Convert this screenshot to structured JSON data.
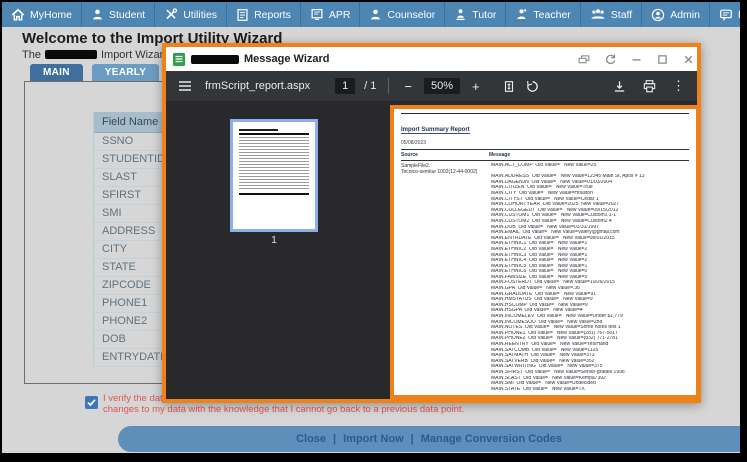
{
  "nav": {
    "items": [
      {
        "label": "MyHome",
        "icon": "home-icon"
      },
      {
        "label": "Student",
        "icon": "student-icon"
      },
      {
        "label": "Utilities",
        "icon": "utilities-icon"
      },
      {
        "label": "Reports",
        "icon": "reports-icon"
      },
      {
        "label": "APR",
        "icon": "apr-icon"
      },
      {
        "label": "Counselor",
        "icon": "counselor-icon"
      },
      {
        "label": "Tutor",
        "icon": "tutor-icon"
      },
      {
        "label": "Teacher",
        "icon": "teacher-icon"
      },
      {
        "label": "Staff",
        "icon": "staff-icon"
      },
      {
        "label": "Admin",
        "icon": "admin-icon"
      },
      {
        "label": "Pt Por",
        "icon": "portal-icon"
      }
    ]
  },
  "page": {
    "title": "Welcome to the Import Utility Wizard",
    "subtitle_prefix": "The",
    "subtitle_suffix": "Import Wizard will he",
    "tabs": [
      {
        "label": "MAIN",
        "active": true
      },
      {
        "label": "YEARLY",
        "active": false
      },
      {
        "label": "",
        "active": false
      }
    ],
    "field_table": {
      "header": "Field Name",
      "rows": [
        "SSNO",
        "STUDENTID",
        "SLAST",
        "SFIRST",
        "SMI",
        "ADDRESS",
        "CITY",
        "STATE",
        "ZIPCODE",
        "PHONE1",
        "PHONE2",
        "DOB",
        "ENTRYDATE"
      ]
    },
    "verify": {
      "checked": true,
      "line1": "I verify the data changes that will occur on import of the source noted above and existing data",
      "line2": "changes to my data with the knowledge that I cannot go back to a previous data point."
    },
    "footer_actions": [
      "Close",
      "Import Now",
      "Manage Conversion Codes"
    ]
  },
  "modal": {
    "title": "Message Wizard",
    "window_icons": [
      "dock-icon",
      "refresh-icon",
      "minimize-icon",
      "maximize-icon",
      "close-icon"
    ],
    "pdf": {
      "filename": "frmScript_report.aspx",
      "page_current": "1",
      "page_total_label": "/ 1",
      "zoom": "50%"
    },
    "thumbnail_label": "1",
    "report": {
      "title": "Import Summary Report",
      "date": "05/08/2023",
      "col_source": "Source",
      "col_message": "Message",
      "source_line1": "SampleFile2.",
      "source_line2": "Tecnico-semkur 1002(12-44-0002)",
      "messages": [
        "MAIN.ACT_COMP  Old Value=   New Value=25",
        "",
        "MAIN.ADDRESS  Old Value=   New Value=12345 Main St, Apos # 13",
        "MAIN.DAGENJN  Old Value=   New Value=01/03/2004",
        "MAIN.CITIZEN  Old Value=   New Value=True",
        "MAIN.CITY  Old Value=   New Value=Houston",
        "MAIN.CITYST  Old Value=   New Value=Cedar 1",
        "MAIN.COHORTYEAR  Old Value=2025  New Value=2027",
        "MAIN.COLLEGEDT  Old Value=   New Value=09/15/2012",
        "MAIN.CUSTOM1  Old Value=   New Value=Custom1 1-1",
        "MAIN.CUSTOM2  Old Value=   New Value=Custom2 4",
        "MAIN.DOB  Old Value=   New Value=01/31/1997",
        "MAIN.EMAIL  Old Value=   New Value=Valery@gmail.com",
        "MAIN.ENTRDATE  Old Value=   New Value=08/01/2015",
        "MAIN.ETHNIC1  Old Value=   New Value=1",
        "MAIN.ETHNIC2  Old Value=   New Value=2",
        "MAIN.ETHNIC3  Old Value=   New Value=1",
        "MAIN.ETHNIC4  Old Value=   New Value=2",
        "MAIN.ETHNIC5  Old Value=   New Value=1",
        "MAIN.ETHNIC6  Old Value=   New Value=0",
        "MAIN.FAMSIZE  Old Value=   New Value=5",
        "MAIN.FOSTERDT  Old Value=   New Value=10/26/2015",
        "MAIN.GPA  Old Value=   New Value=.36",
        "MAIN.GRADDATE  Old Value=   New Value=91",
        "MAIN.HMSTATUS  Old Value=   New Value=9",
        "MAIN.HSCOMP  Old Value=   New Value=9",
        "MAIN.HSGPA  Old Value=   New Value=4",
        "MAIN.INCOMELEV  Old Value=   New Value=Under $1,779",
        "MAIN.INCOMESOU  Old Value=   New Value=2nd",
        "MAIN.NOTES  Old Value=   New Value=Some notes test 1",
        "MAIN.PHONE1  Old Value=   New Value=(281) 767-5017",
        "MAIN.PHONE2  Old Value=   New Value=(832) 771-2781",
        "MAIN.REENTRY  Old Value=   New Value=Yes/Hand",
        "MAIN.SATCOMB  Old Value=   New Value=1125",
        "MAIN.SATMATH  Old Value=   New Value=373",
        "MAIN.SATVERB  Old Value=   New Value=352",
        "MAIN.SATWRITING  Old Value=   New Value=375",
        "MAIN.SFIRST  Old Value=   New Value=Senior-grades 1998",
        "MAIN.SLAST  Old Value=   New Value=Kempa7392",
        "MAIN.SMI  Old Value=   New Value=Undecided",
        "MAIN.STATE  Old Value=   New Value=TX"
      ]
    }
  },
  "colors": {
    "nav_blue": "#4D86B3",
    "accent_orange": "#F08119",
    "tab_active": "#3F6F9D",
    "tab_inactive": "#6B9CC3",
    "footer_bar": "#5E8FBB",
    "footer_text": "#2B5C8A",
    "verify_red": "#E05555",
    "checkbox_blue": "#3C76BD",
    "selection_blue": "#8AB0EE",
    "toolbar_dark": "#323639",
    "viewer_bg": "#29292B",
    "doc_icon_green": "#2F9E4E"
  }
}
